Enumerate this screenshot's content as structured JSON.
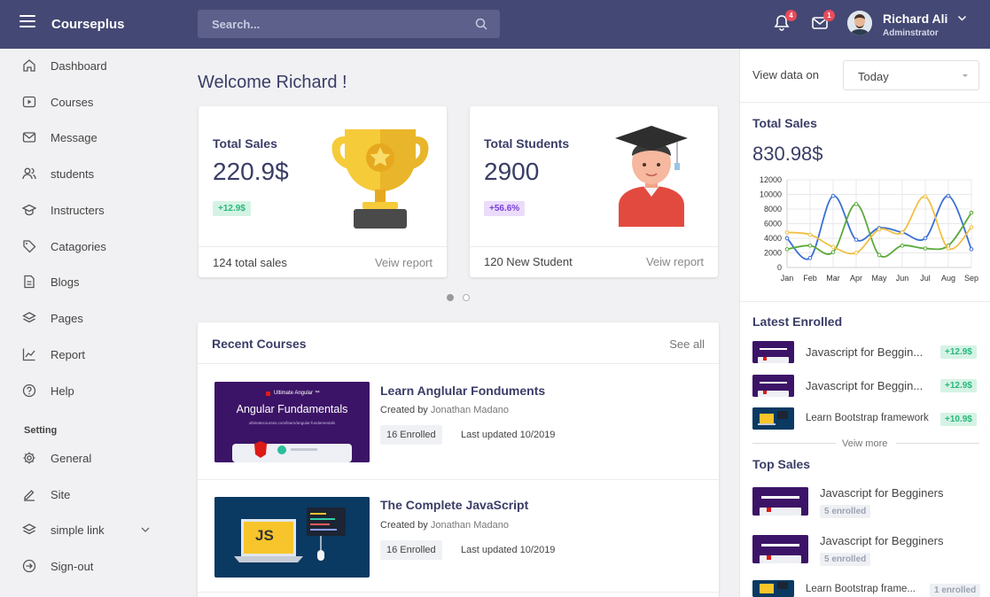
{
  "topbar": {
    "brand": "Courseplus",
    "search_placeholder": "Search...",
    "notifications_count": "4",
    "messages_count": "1",
    "user_name": "Richard Ali",
    "user_role": "Adminstrator"
  },
  "sidebar": {
    "items": [
      {
        "label": "Dashboard",
        "icon": "home-icon"
      },
      {
        "label": "Courses",
        "icon": "play-square-icon"
      },
      {
        "label": "Message",
        "icon": "mail-icon"
      },
      {
        "label": "students",
        "icon": "users-icon"
      },
      {
        "label": "Instructers",
        "icon": "graduation-cap-icon"
      },
      {
        "label": "Catagories",
        "icon": "tag-icon"
      },
      {
        "label": "Blogs",
        "icon": "document-icon"
      },
      {
        "label": "Pages",
        "icon": "layers-icon"
      },
      {
        "label": "Report",
        "icon": "chart-line-icon"
      },
      {
        "label": "Help",
        "icon": "help-icon"
      }
    ],
    "section_label": "Setting",
    "settings": [
      {
        "label": "General",
        "icon": "gear-icon"
      },
      {
        "label": "Site",
        "icon": "edit-icon"
      },
      {
        "label": "simple link",
        "icon": "layers-icon"
      },
      {
        "label": "Sign-out",
        "icon": "sign-out-icon"
      }
    ]
  },
  "main": {
    "welcome": "Welcome Richard !",
    "cards": [
      {
        "title": "Total Sales",
        "value": "220.9$",
        "badge": "+12.9$",
        "footer": "124 total sales",
        "link": "Veiw report"
      },
      {
        "title": "Total Students",
        "value": "2900",
        "badge": "+56.6%",
        "footer": "120 New Student",
        "link": "Veiw report"
      }
    ],
    "recent": {
      "title": "Recent Courses",
      "see_all": "See all",
      "courses": [
        {
          "name": "Learn Anglular Fonduments",
          "created_by": "Created by",
          "author": "Jonathan Madano",
          "enrolled": "16 Enrolled",
          "updated": "Last updated 10/2019",
          "thumb_title": "Angular Fundamentals",
          "thumb_sub": "Ultimate Angular ™",
          "thumb_url": "ultimatecourses.com/learn/angular-fundamentals"
        },
        {
          "name": "The Complete JavaScript",
          "created_by": "Created by",
          "author": "Jonathan Madano",
          "enrolled": "16 Enrolled",
          "updated": "Last updated 10/2019",
          "thumb_title": "JS"
        }
      ]
    }
  },
  "right": {
    "view_label": "View data on",
    "view_value": "Today",
    "sales_title": "Total Sales",
    "sales_value": "830.98$",
    "latest_title": "Latest Enrolled",
    "latest": [
      {
        "name": "Javascript for Beggin...",
        "badge": "+12.9$"
      },
      {
        "name": "Javascript for Beggin...",
        "badge": "+12.9$"
      },
      {
        "name": "Learn Bootstrap framework",
        "badge": "+10.9$"
      }
    ],
    "view_more": "Veiw more",
    "top_title": "Top Sales",
    "top": [
      {
        "name": "Javascript for Begginers",
        "badge": "5 enrolled"
      },
      {
        "name": "Javascript for Begginers",
        "badge": "5 enrolled"
      },
      {
        "name": "Learn Bootstrap frame...",
        "badge": "1 enrolled"
      }
    ]
  },
  "colors": {
    "topbar": "#444874",
    "accent_green": "#29b87a",
    "accent_purple": "#7a3fd6",
    "series_blue": "#3b6fd4",
    "series_green": "#5aaa3a",
    "series_yellow": "#f0c044"
  },
  "chart_data": {
    "type": "line",
    "categories": [
      "Jan",
      "Feb",
      "Mar",
      "Apr",
      "May",
      "Jun",
      "Jul",
      "Aug",
      "Sep"
    ],
    "ylim": [
      0,
      12000
    ],
    "yticks": [
      0,
      2000,
      4000,
      6000,
      8000,
      10000,
      12000
    ],
    "grid": true,
    "series": [
      {
        "color": "#3b6fd4",
        "values": [
          4000,
          1300,
          9800,
          3800,
          5400,
          4800,
          4000,
          9800,
          2500
        ]
      },
      {
        "color": "#5aaa3a",
        "values": [
          2500,
          3000,
          2100,
          8700,
          1700,
          3000,
          2600,
          3000,
          7500
        ]
      },
      {
        "color": "#f0c044",
        "values": [
          4800,
          4500,
          2800,
          2000,
          5200,
          4800,
          9700,
          2600,
          5500
        ]
      }
    ]
  }
}
